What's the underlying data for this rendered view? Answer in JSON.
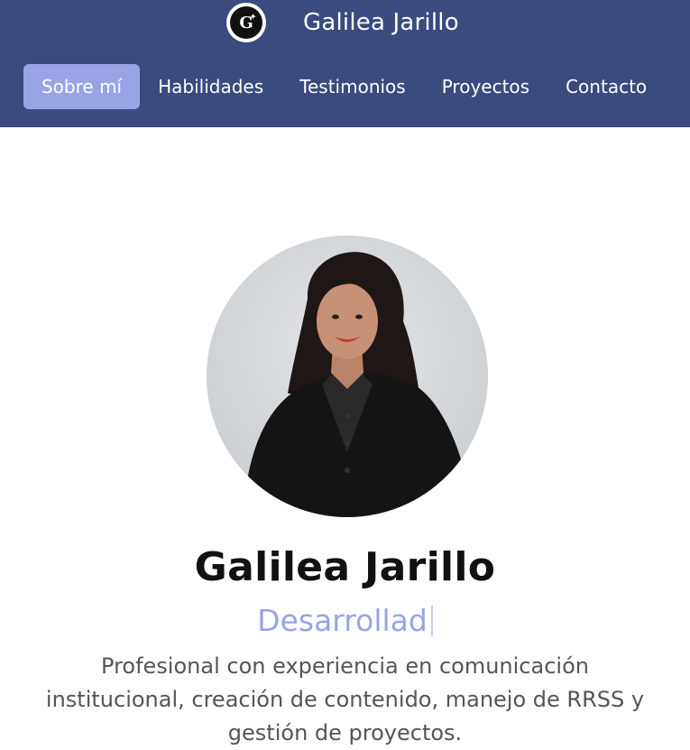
{
  "header": {
    "brand_name": "Galilea Jarillo",
    "logo_letter": "G",
    "nav": [
      {
        "label": "Sobre mí",
        "active": true
      },
      {
        "label": "Habilidades",
        "active": false
      },
      {
        "label": "Testimonios",
        "active": false
      },
      {
        "label": "Proyectos",
        "active": false
      },
      {
        "label": "Contacto",
        "active": false
      }
    ]
  },
  "hero": {
    "photo_icon": "profile-photo",
    "name": "Galilea Jarillo",
    "role_typed": "Desarrollad",
    "description": "Profesional con experiencia en comunicación institucional, creación de contenido, manejo de RRSS y gestión de proyectos."
  },
  "colors": {
    "header_bg": "#3b4a7f",
    "accent": "#9aa3e6"
  }
}
